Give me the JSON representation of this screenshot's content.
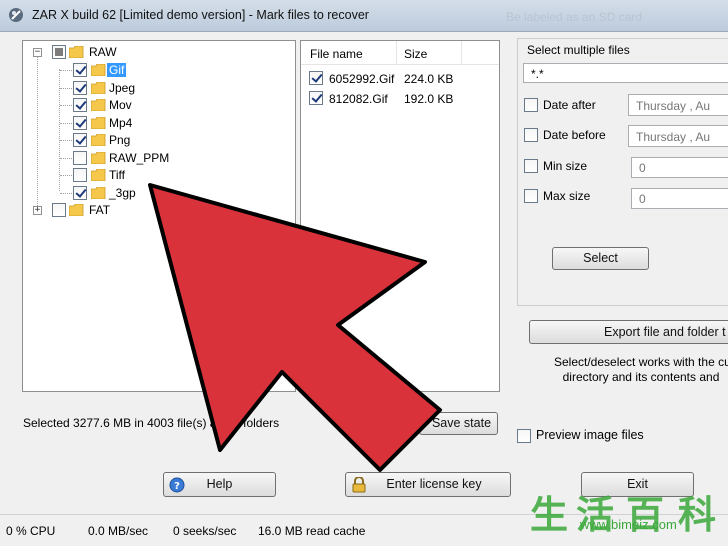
{
  "window": {
    "title": "ZAR X build 62 [Limited demo version] - Mark files to recover",
    "background_title": "Be labeled as an SD card"
  },
  "tree": {
    "root_label": "RAW",
    "items": [
      {
        "label": "Gif",
        "checked": true,
        "selected": true
      },
      {
        "label": "Jpeg",
        "checked": true
      },
      {
        "label": "Mov",
        "checked": true
      },
      {
        "label": "Mp4",
        "checked": true
      },
      {
        "label": "Png",
        "checked": true
      },
      {
        "label": "RAW_PPM",
        "checked": false
      },
      {
        "label": "Tiff",
        "checked": false
      },
      {
        "label": "_3gp",
        "checked": true
      }
    ],
    "second_root_label": "FAT"
  },
  "file_list": {
    "columns": [
      "File name",
      "Size"
    ],
    "rows": [
      {
        "name": "6052992.Gif",
        "size": "224.0 KB",
        "checked": true
      },
      {
        "name": "812082.Gif",
        "size": "192.0 KB",
        "checked": true
      }
    ]
  },
  "selection": {
    "group_title": "Select multiple files",
    "mask_value": "*.*",
    "date_after_label": "Date after",
    "date_after_value": "Thursday ,  Au",
    "date_before_label": "Date before",
    "date_before_value": "Thursday ,  Au",
    "min_size_label": "Min size",
    "min_size_value": "0",
    "max_size_label": "Max size",
    "max_size_value": "0",
    "select_button": "Select"
  },
  "export": {
    "button_label": "Export file and folder t",
    "hint_line1": "Select/deselect works with the cu",
    "hint_line2": "directory and its contents and",
    "preview_label": "Preview image files"
  },
  "summary": {
    "selected_text": "Selected 3277.6 MB in 4003 file(s) and 7 folders",
    "save_state_button": "Save state"
  },
  "buttons": {
    "help": "Help",
    "license": "Enter license key",
    "exit": "Exit"
  },
  "status": {
    "cpu": "0 % CPU",
    "throughput": "0.0 MB/sec",
    "seeks": "0 seeks/sec",
    "cache": "16.0 MB read cache"
  },
  "watermark": {
    "chars": [
      "生",
      "活",
      "百",
      "科"
    ],
    "url": "www.bimeiz.com"
  },
  "colors": {
    "arrow_red": "#d9323a",
    "selection_blue": "#3399ff",
    "folder_yellow": "#f5c84c",
    "watermark_green": "#3aa83a"
  }
}
